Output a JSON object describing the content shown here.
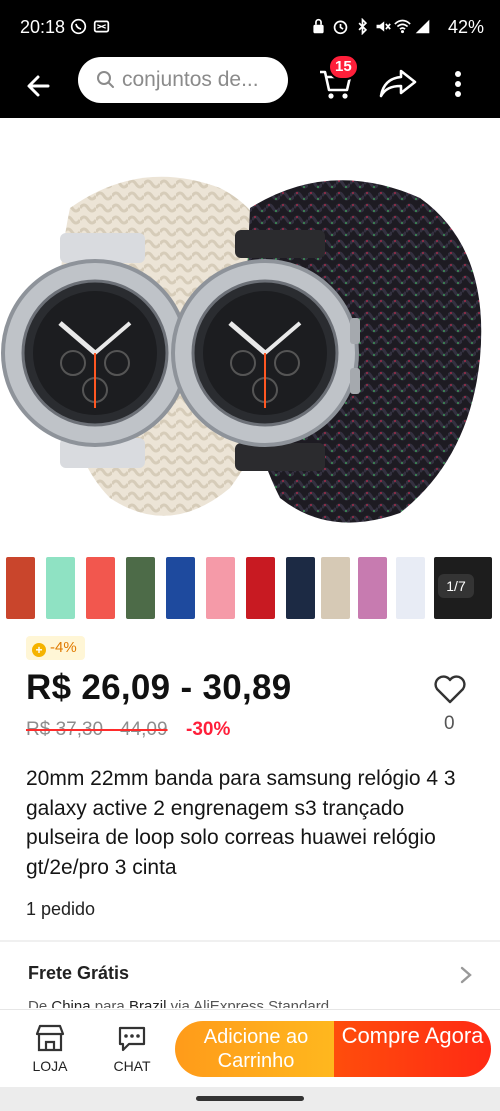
{
  "status_bar": {
    "time": "20:18",
    "battery": "42%"
  },
  "header": {
    "search_placeholder": "conjuntos de...",
    "cart_count": "15"
  },
  "gallery": {
    "page_indicator": "1/7",
    "thumbnail_colors": [
      "#c9452c",
      "#8fe2c3",
      "#f2574e",
      "#4d6b48",
      "#1e4a9e",
      "#f59aa8",
      "#c81a22",
      "#1c2a44",
      "#d6c9b5",
      "#c77bb0",
      "#e8ecf5",
      "#1d1d1d"
    ]
  },
  "product": {
    "coin_discount": "-4%",
    "price_range": "R$ 26,09 - 30,89",
    "original_price": "R$ 37,30 - 44,09",
    "discount": "-30%",
    "favorites_count": "0",
    "title": "20mm 22mm banda para samsung relógio 4 3 galaxy active 2 engrenagem s3 trançado pulseira de loop solo correas huawei relógio gt/2e/pro 3 cinta",
    "orders": "1 pedido"
  },
  "shipping": {
    "title": "Frete Grátis",
    "subtitle_prefix": "De",
    "origin": "China",
    "middle": "para",
    "destination": "Brazil",
    "suffix": "via AliExpress Standard"
  },
  "bottom_bar": {
    "store_label": "LOJA",
    "chat_label": "CHAT",
    "add_to_cart_label": "Adicione ao Carrinho",
    "buy_now_label": "Compre Agora"
  },
  "colors": {
    "accent_red": "#ff1f3a",
    "cart_orange": "#ffa41b",
    "buy_red": "#ff3a10"
  }
}
